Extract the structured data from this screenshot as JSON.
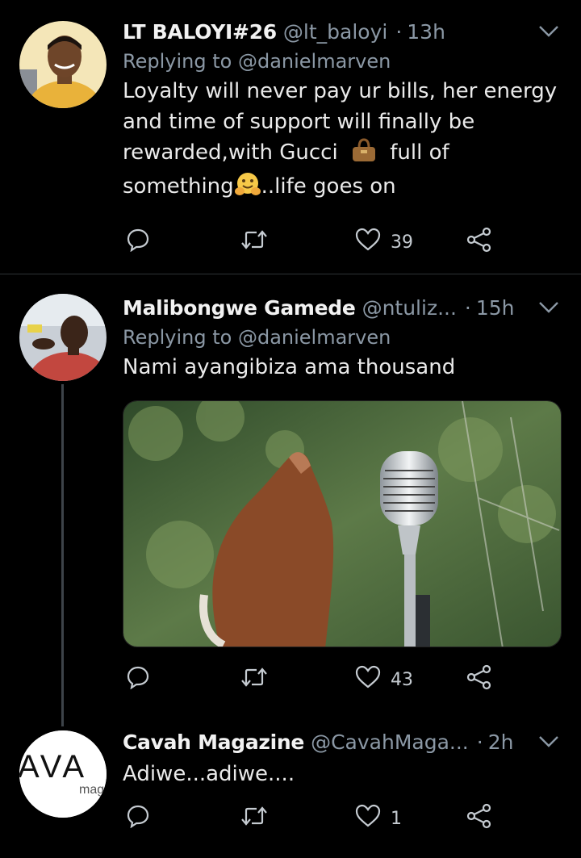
{
  "tweets": [
    {
      "name": "LT BALOYI#26",
      "handle": "@lt_baloyi",
      "time": "13h",
      "replying_prefix": "Replying to",
      "replying_to": "@danielmarven",
      "text_line1": "Loyalty will never pay ur bills, her energy",
      "text_line2": "and time of support will finally be",
      "text_line3a": "rewarded,with Gucci",
      "text_line3b": "full of",
      "text_line4a": "something",
      "text_line4b": "..life goes on",
      "likes": "39",
      "retweets": "",
      "replies": ""
    },
    {
      "name": "Malibongwe Gamede",
      "handle": "@ntuliz...",
      "time": "15h",
      "replying_prefix": "Replying to",
      "replying_to": "@danielmarven",
      "text": "Nami ayangibiza ama thousand",
      "likes": "43"
    },
    {
      "name": "Cavah Magazine",
      "handle": "@CavahMaga...",
      "time": "2h",
      "text": "Adiwe...adiwe....",
      "likes": "1",
      "avatar_logo_text": "AVA",
      "avatar_sub_text": "mag"
    }
  ],
  "separator": "·",
  "icons": [
    "reply-icon",
    "retweet-icon",
    "heart-icon",
    "share-icon",
    "chevron-down-icon",
    "handbag-emoji",
    "hugging-face-emoji"
  ],
  "colors": {
    "background": "#000000",
    "text": "#eaeaea",
    "secondary": "#8b98a5",
    "divider": "#2f3336"
  }
}
